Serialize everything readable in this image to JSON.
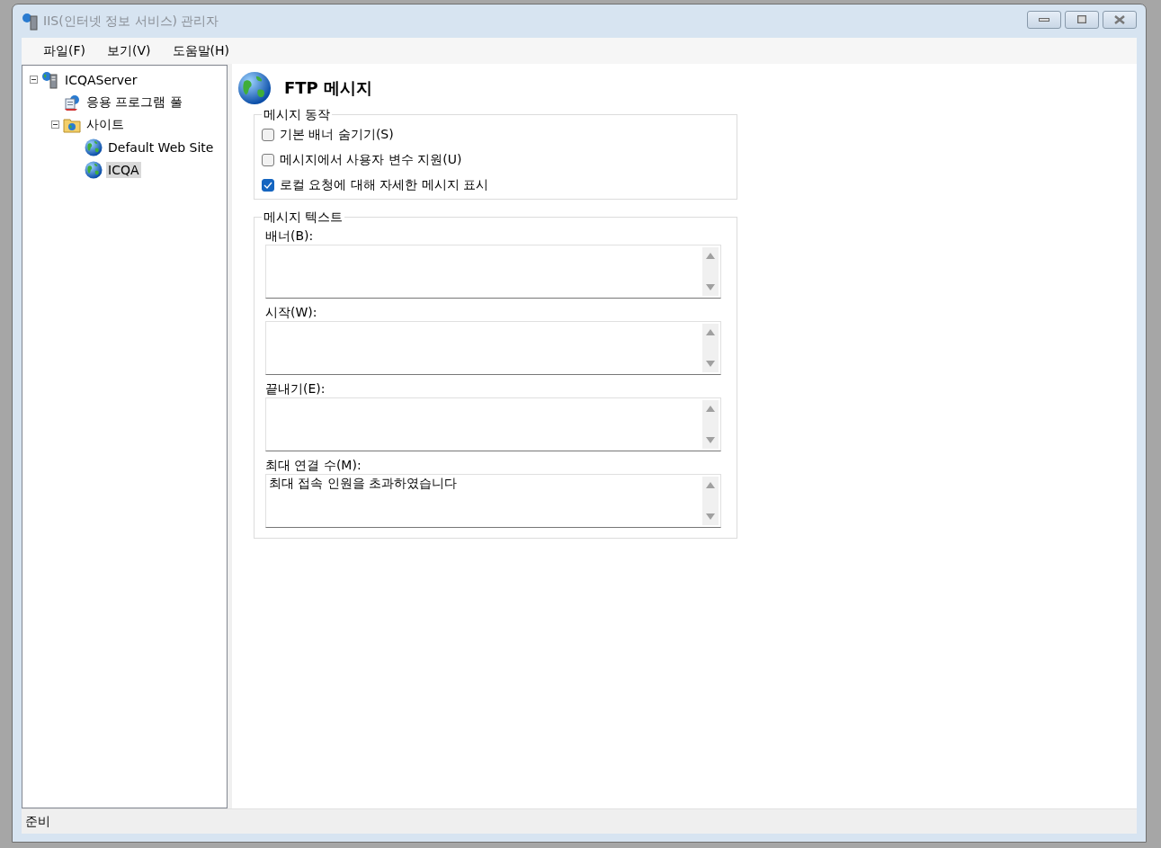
{
  "window": {
    "title": "IIS(인터넷 정보 서비스) 관리자"
  },
  "menu": [
    "파일(F)",
    "보기(V)",
    "도움말(H)"
  ],
  "tree": [
    {
      "label": "ICQAServer",
      "kind": "server",
      "expanded": true,
      "selected": false,
      "children": [
        {
          "label": "응용 프로그램 풀",
          "kind": "pool",
          "selected": false
        },
        {
          "label": "사이트",
          "kind": "folder",
          "expanded": true,
          "selected": false,
          "children": [
            {
              "label": "Default Web Site",
              "kind": "site",
              "selected": false
            },
            {
              "label": "ICQA",
              "kind": "site",
              "selected": true
            }
          ]
        }
      ]
    }
  ],
  "page": {
    "title": "FTP 메시지"
  },
  "behavior": {
    "legend": "메시지 동작",
    "options": [
      {
        "label": "기본 배너 숨기기(S)",
        "checked": false
      },
      {
        "label": "메시지에서 사용자 변수 지원(U)",
        "checked": false
      },
      {
        "label": "로컬 요청에 대해 자세한 메시지 표시",
        "checked": true
      }
    ]
  },
  "messages": {
    "legend": "메시지 텍스트",
    "fields": [
      {
        "label": "배너(B):"
      },
      {
        "label": "시작(W):"
      },
      {
        "label": "끝내기(E):"
      },
      {
        "label": "최대 연결 수(M):",
        "value": "최대 접속 인원을 초과하였습니다"
      }
    ]
  },
  "status_bar": "준비"
}
